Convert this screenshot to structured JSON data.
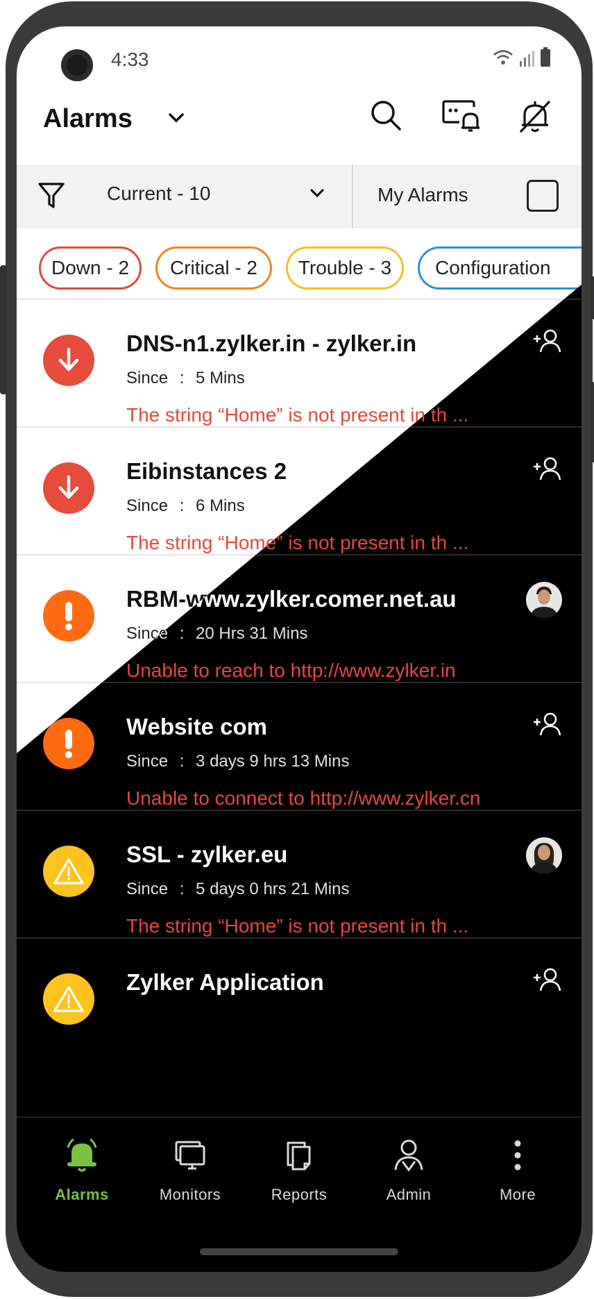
{
  "status_bar": {
    "time": "4:33"
  },
  "header": {
    "title": "Alarms",
    "icons": [
      "search-icon",
      "bell-device-icon",
      "mute-bell-icon"
    ]
  },
  "filter": {
    "selected": "Current - 10",
    "my_alarms_label": "My Alarms",
    "my_alarms_checked": false
  },
  "chips": [
    {
      "label": "Down - 2",
      "color": "#e0493c"
    },
    {
      "label": "Critical - 2",
      "color": "#f0851f"
    },
    {
      "label": "Trouble - 3",
      "color": "#f4c01e"
    },
    {
      "label": "Configuration",
      "color": "#2a8fd6"
    }
  ],
  "alarms": [
    {
      "name": "DNS-n1.zylker.in - zylker.in",
      "since_label": "Since",
      "since": "5 Mins",
      "message": "The string “Home” is not present in th ...",
      "severity": "down",
      "assignee": "add-user-icon"
    },
    {
      "name": "Eibinstances 2",
      "since_label": "Since",
      "since": "6 Mins",
      "message": "The string “Home” is not present in th ...",
      "severity": "down",
      "assignee": "add-user-icon"
    },
    {
      "name": "RBM-www.zylker.comer.net.au",
      "since_label": "Since",
      "since": "20 Hrs 31 Mins",
      "message": "Unable to reach to http://www.zylker.in",
      "severity": "critical",
      "assignee": "avatar-male"
    },
    {
      "name": "Website com",
      "since_label": "Since",
      "since": "3 days 9 hrs 13 Mins",
      "message": "Unable to connect to http://www.zylker.cn",
      "severity": "critical",
      "assignee": "add-user-icon"
    },
    {
      "name": "SSL - zylker.eu",
      "since_label": "Since",
      "since": "5 days 0 hrs 21 Mins",
      "message": "The string “Home” is not present in th ...",
      "severity": "trouble",
      "assignee": "avatar-female"
    },
    {
      "name": "Zylker Application",
      "since_label": "",
      "since": "",
      "message": "",
      "severity": "trouble",
      "assignee": "add-user-icon"
    }
  ],
  "severity_colors": {
    "down": "#e64b3c",
    "critical": "#ff6a13",
    "trouble": "#ffc21f"
  },
  "nav": [
    {
      "label": "Alarms",
      "icon": "bell-icon",
      "active": true
    },
    {
      "label": "Monitors",
      "icon": "monitors-icon",
      "active": false
    },
    {
      "label": "Reports",
      "icon": "reports-icon",
      "active": false
    },
    {
      "label": "Admin",
      "icon": "admin-icon",
      "active": false
    },
    {
      "label": "More",
      "icon": "more-icon",
      "active": false
    }
  ],
  "accent": "#7ac142"
}
